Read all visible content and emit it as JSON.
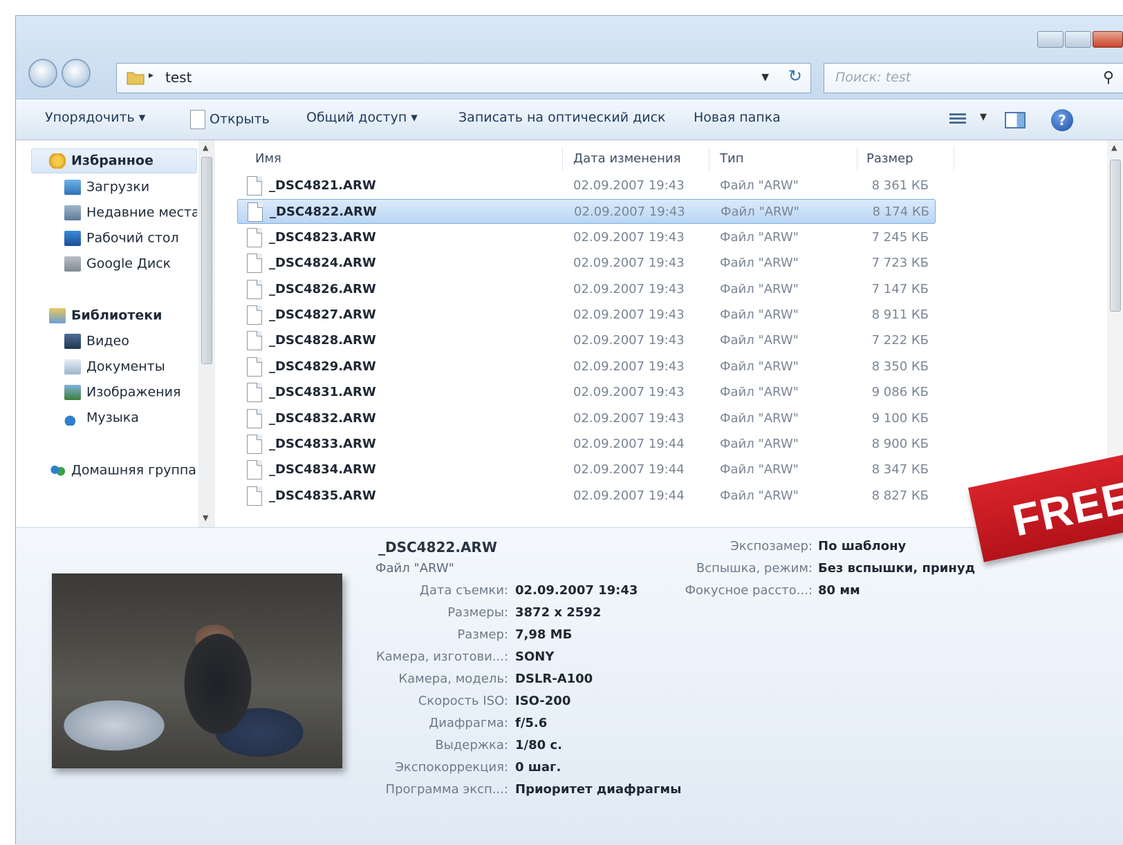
{
  "address": {
    "path": "test"
  },
  "search": {
    "placeholder": "Поиск: test"
  },
  "toolbar": {
    "organize": "Упорядочить ▾",
    "open": "Открыть",
    "share": "Общий доступ ▾",
    "burn": "Записать на оптический диск",
    "new_folder": "Новая папка"
  },
  "nav": {
    "favorites": "Избранное",
    "downloads": "Загрузки",
    "recent": "Недавние места",
    "desktop": "Рабочий стол",
    "gdrive": "Google Диск",
    "libraries": "Библиотеки",
    "video": "Видео",
    "documents": "Документы",
    "pictures": "Изображения",
    "music": "Музыка",
    "homegroup": "Домашняя группа"
  },
  "columns": {
    "name": "Имя",
    "date": "Дата изменения",
    "type": "Тип",
    "size": "Размер"
  },
  "files": [
    {
      "name": "_DSC4821.ARW",
      "date": "02.09.2007 19:43",
      "type": "Файл \"ARW\"",
      "size": "8 361 КБ"
    },
    {
      "name": "_DSC4822.ARW",
      "date": "02.09.2007 19:43",
      "type": "Файл \"ARW\"",
      "size": "8 174 КБ"
    },
    {
      "name": "_DSC4823.ARW",
      "date": "02.09.2007 19:43",
      "type": "Файл \"ARW\"",
      "size": "7 245 КБ"
    },
    {
      "name": "_DSC4824.ARW",
      "date": "02.09.2007 19:43",
      "type": "Файл \"ARW\"",
      "size": "7 723 КБ"
    },
    {
      "name": "_DSC4826.ARW",
      "date": "02.09.2007 19:43",
      "type": "Файл \"ARW\"",
      "size": "7 147 КБ"
    },
    {
      "name": "_DSC4827.ARW",
      "date": "02.09.2007 19:43",
      "type": "Файл \"ARW\"",
      "size": "8 911 КБ"
    },
    {
      "name": "_DSC4828.ARW",
      "date": "02.09.2007 19:43",
      "type": "Файл \"ARW\"",
      "size": "7 222 КБ"
    },
    {
      "name": "_DSC4829.ARW",
      "date": "02.09.2007 19:43",
      "type": "Файл \"ARW\"",
      "size": "8 350 КБ"
    },
    {
      "name": "_DSC4831.ARW",
      "date": "02.09.2007 19:43",
      "type": "Файл \"ARW\"",
      "size": "9 086 КБ"
    },
    {
      "name": "_DSC4832.ARW",
      "date": "02.09.2007 19:43",
      "type": "Файл \"ARW\"",
      "size": "9 100 КБ"
    },
    {
      "name": "_DSC4833.ARW",
      "date": "02.09.2007 19:44",
      "type": "Файл \"ARW\"",
      "size": "8 900 КБ"
    },
    {
      "name": "_DSC4834.ARW",
      "date": "02.09.2007 19:44",
      "type": "Файл \"ARW\"",
      "size": "8 347 КБ"
    },
    {
      "name": "_DSC4835.ARW",
      "date": "02.09.2007 19:44",
      "type": "Файл \"ARW\"",
      "size": "8 827 КБ"
    }
  ],
  "details": {
    "filename": "_DSC4822.ARW",
    "filetype": "Файл \"ARW\"",
    "props_left": [
      {
        "label": "Дата съемки:",
        "value": "02.09.2007 19:43"
      },
      {
        "label": "Размеры:",
        "value": "3872 x 2592"
      },
      {
        "label": "Размер:",
        "value": "7,98 МБ"
      },
      {
        "label": "Камера, изготови...:",
        "value": "SONY"
      },
      {
        "label": "Камера, модель:",
        "value": "DSLR-A100"
      },
      {
        "label": "Скорость ISO:",
        "value": "ISO-200"
      },
      {
        "label": "Диафрагма:",
        "value": "f/5.6"
      },
      {
        "label": "Выдержка:",
        "value": "1/80 с."
      },
      {
        "label": "Экспокоррекция:",
        "value": "0 шаг."
      },
      {
        "label": "Программа эксп...:",
        "value": "Приоритет диафрагмы"
      }
    ],
    "props_right": [
      {
        "label": "Экспозамер:",
        "value": "По шаблону"
      },
      {
        "label": "Вспышка, режим:",
        "value": "Без вспышки, принуд"
      },
      {
        "label": "Фокусное рассто...:",
        "value": "80 мм"
      }
    ]
  },
  "banner": {
    "text": "FREE"
  },
  "icons": {
    "back": "back-arrow-icon",
    "forward": "forward-arrow-icon",
    "folder": "folder-icon",
    "refresh": "refresh-icon",
    "search": "magnifier-icon",
    "help": "help-icon",
    "file": "document-icon"
  },
  "colors": {
    "selection": "#b9d6f4",
    "banner": "#c8181f",
    "accent": "#1f3a5c"
  }
}
